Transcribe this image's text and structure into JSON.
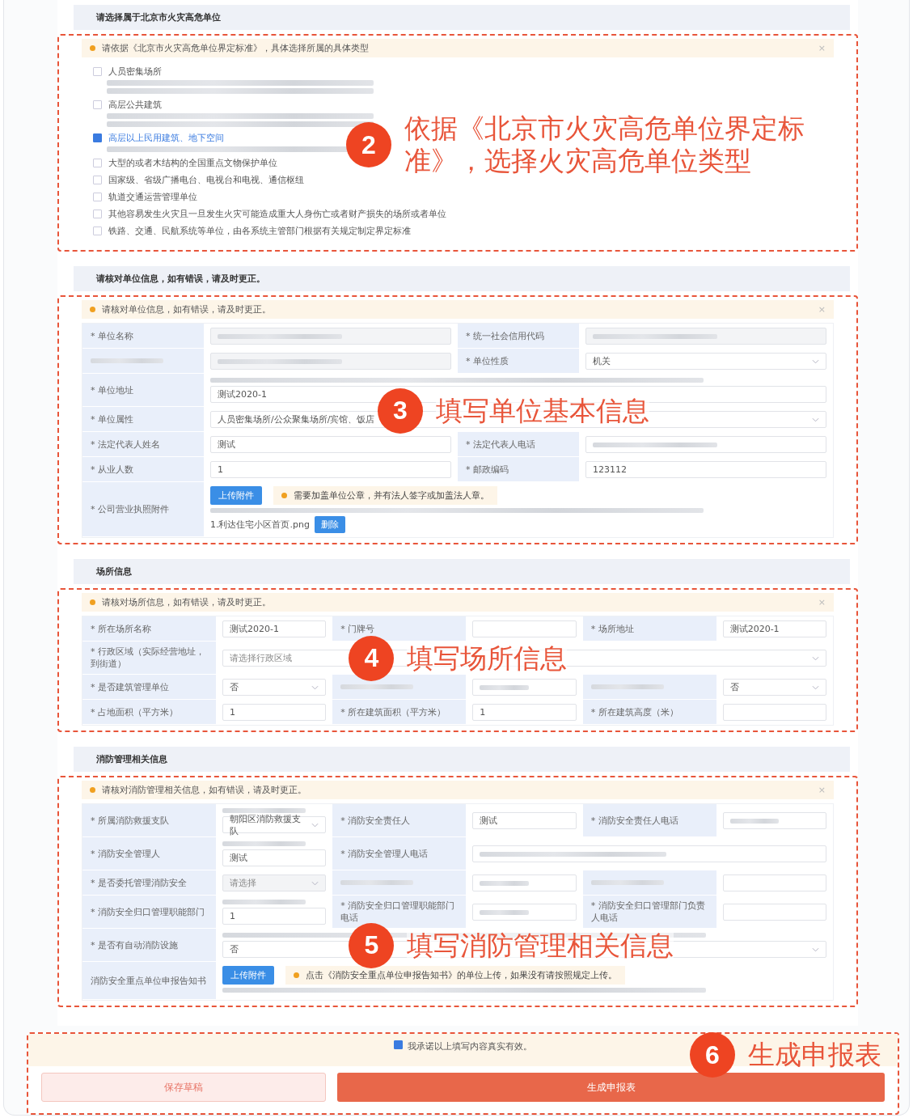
{
  "sections": [
    {
      "kind": "checklist",
      "title": "请选择属于北京市火灾高危单位",
      "alert": {
        "text": "请依据《北京市火灾高危单位界定标准》，具体选择所属的具体类型",
        "close": "×"
      },
      "annotation": {
        "number": "2",
        "text": "依据《北京市火灾高危单位界定标准》，选择火灾高危单位类型"
      },
      "options": [
        {
          "label": "人员密集场所",
          "checked": false,
          "kind": "described"
        },
        {
          "label": "高层公共建筑",
          "checked": false,
          "kind": "described"
        },
        {
          "label": "高层以上民用建筑、地下空间",
          "checked": true,
          "kind": "described"
        },
        {
          "label": "大型的或者木结构的全国重点文物保护单位",
          "checked": false,
          "kind": "plain"
        },
        {
          "label": "国家级、省级广播电台、电视台和电视、通信枢纽",
          "checked": false,
          "kind": "plain"
        },
        {
          "label": "轨道交通运营管理单位",
          "checked": false,
          "kind": "plain"
        },
        {
          "label": "其他容易发生火灾且一旦发生火灾可能造成重大人身伤亡或者财产损失的场所或者单位",
          "checked": false,
          "kind": "plain"
        },
        {
          "label": "铁路、交通、民航系统等单位，由各系统主管部门根据有关规定制定界定标准",
          "checked": false,
          "kind": "plain"
        }
      ]
    },
    {
      "kind": "form",
      "title": "请核对单位信息，如有错误，请及时更正。",
      "alert": {
        "text": "请核对单位信息，如有错误，请及时更正。",
        "close": "×"
      },
      "annotation": {
        "number": "3",
        "text": "填写单位基本信息"
      },
      "rows": [
        [
          {
            "label": "* 单位名称",
            "field": {
              "kind": "input",
              "disabled": true,
              "blurred": true
            }
          },
          {
            "label": "* 统一社会信用代码",
            "field": {
              "kind": "input",
              "disabled": true,
              "blurred": true
            }
          }
        ],
        [
          {
            "label_blurred": true,
            "field": {
              "kind": "input",
              "disabled": true,
              "blurred": true
            }
          },
          {
            "label": "* 单位性质",
            "field": {
              "kind": "select",
              "value": "机关"
            }
          }
        ],
        [
          {
            "label": "* 单位地址",
            "wide": true,
            "field": {
              "kind": "input",
              "hint": true,
              "value": "测试2020-1"
            }
          }
        ],
        [
          {
            "label": "* 单位属性",
            "wide": true,
            "field": {
              "kind": "select",
              "value": "人员密集场所/公众聚集场所/宾馆、饭店"
            }
          }
        ],
        [
          {
            "label": "* 法定代表人姓名",
            "field": {
              "kind": "input",
              "value": "测试"
            }
          },
          {
            "label": "* 法定代表人电话",
            "field": {
              "kind": "input",
              "blurred": true
            }
          }
        ],
        [
          {
            "label": "* 从业人数",
            "field": {
              "kind": "input",
              "value": "1"
            }
          },
          {
            "label": "* 邮政编码",
            "field": {
              "kind": "input",
              "value": "123112"
            }
          }
        ],
        [
          {
            "label": "* 公司营业执照附件",
            "wide": true,
            "field": {
              "kind": "upload",
              "button": "上传附件",
              "notice": "需要加盖单位公章，并有法人签字或加盖法人章。",
              "hint": true,
              "file": {
                "name": "1.利达住宅小区首页.png",
                "action": "删除"
              }
            }
          }
        ]
      ]
    },
    {
      "kind": "form",
      "title": "场所信息",
      "alert": {
        "text": "请核对场所信息，如有错误，请及时更正。",
        "close": "×"
      },
      "annotation": {
        "number": "4",
        "text": "填写场所信息"
      },
      "rows": [
        [
          {
            "label": "* 所在场所名称",
            "field": {
              "kind": "input",
              "value": "测试2020-1"
            }
          },
          {
            "label": "* 门牌号",
            "field": {
              "kind": "input"
            }
          },
          {
            "label": "* 场所地址",
            "field": {
              "kind": "input",
              "value": "测试2020-1"
            }
          }
        ],
        [
          {
            "label": "* 行政区域（实际经营地址，到街道）",
            "wide": true,
            "field": {
              "kind": "select",
              "placeholder": "请选择行政区域"
            }
          }
        ],
        [
          {
            "label": "* 是否建筑管理单位",
            "field": {
              "kind": "select",
              "value": "否"
            }
          },
          {
            "label_blurred": true,
            "field": {
              "kind": "input",
              "blurred": true
            }
          },
          {
            "label_blurred": true,
            "field": {
              "kind": "select",
              "value": "否"
            }
          }
        ],
        [
          {
            "label": "* 占地面积（平方米）",
            "field": {
              "kind": "input",
              "value": "1"
            }
          },
          {
            "label": "* 所在建筑面积（平方米）",
            "field": {
              "kind": "input",
              "value": "1"
            }
          },
          {
            "label": "* 所在建筑高度（米）",
            "field": {
              "kind": "input"
            }
          }
        ]
      ]
    },
    {
      "kind": "form",
      "title": "消防管理相关信息",
      "alert": {
        "text": "请核对消防管理相关信息，如有错误，请及时更正。",
        "close": "×"
      },
      "annotation": {
        "number": "5",
        "text": "填写消防管理相关信息"
      },
      "rows": [
        [
          {
            "label": "* 所属消防救援支队",
            "field": {
              "kind": "select",
              "hint": true,
              "value": "朝阳区消防救援支队"
            }
          },
          {
            "label": "* 消防安全责任人",
            "field": {
              "kind": "input",
              "value": "测试"
            }
          },
          {
            "label": "* 消防安全责任人电话",
            "field": {
              "kind": "input",
              "blurred": true
            }
          }
        ],
        [
          {
            "label": "* 消防安全管理人",
            "field": {
              "kind": "input",
              "hint": true,
              "value": "测试"
            }
          },
          {
            "label": "* 消防安全管理人电话",
            "wide": true,
            "field": {
              "kind": "input",
              "blurred": true
            }
          }
        ],
        [
          {
            "label": "* 是否委托管理消防安全",
            "field": {
              "kind": "select",
              "disabled": true,
              "placeholder": "请选择"
            }
          },
          {
            "label_blurred": true,
            "field": {
              "kind": "input",
              "blurred": true
            }
          },
          {
            "label_blurred": true,
            "field": {
              "kind": "input"
            }
          }
        ],
        [
          {
            "label": "* 消防安全归口管理职能部门",
            "field": {
              "kind": "input",
              "hint": true,
              "value": "1"
            }
          },
          {
            "label": "* 消防安全归口管理职能部门电话",
            "field": {
              "kind": "input",
              "blurred": true
            }
          },
          {
            "label": "* 消防安全归口管理部门负责人电话",
            "field": {
              "kind": "input"
            }
          }
        ],
        [
          {
            "label": "* 是否有自动消防设施",
            "wide": true,
            "field": {
              "kind": "select",
              "hint": true,
              "value": "否"
            }
          }
        ],
        [
          {
            "label": "消防安全重点单位申报告知书",
            "wide": true,
            "field": {
              "kind": "upload",
              "button": "上传附件",
              "notice": "点击《消防安全重点单位申报告知书》的单位上传，如果没有请按照规定上传。",
              "hint": true
            }
          }
        ]
      ]
    }
  ],
  "footer": {
    "pledge": {
      "text": "我承诺以上填写内容真实有效。",
      "checked": true
    },
    "annotation": {
      "number": "6",
      "text": "生成申报表"
    },
    "buttons": [
      {
        "label": "保存草稿",
        "kind": "secondary"
      },
      {
        "label": "生成申报表",
        "kind": "primary"
      }
    ]
  }
}
